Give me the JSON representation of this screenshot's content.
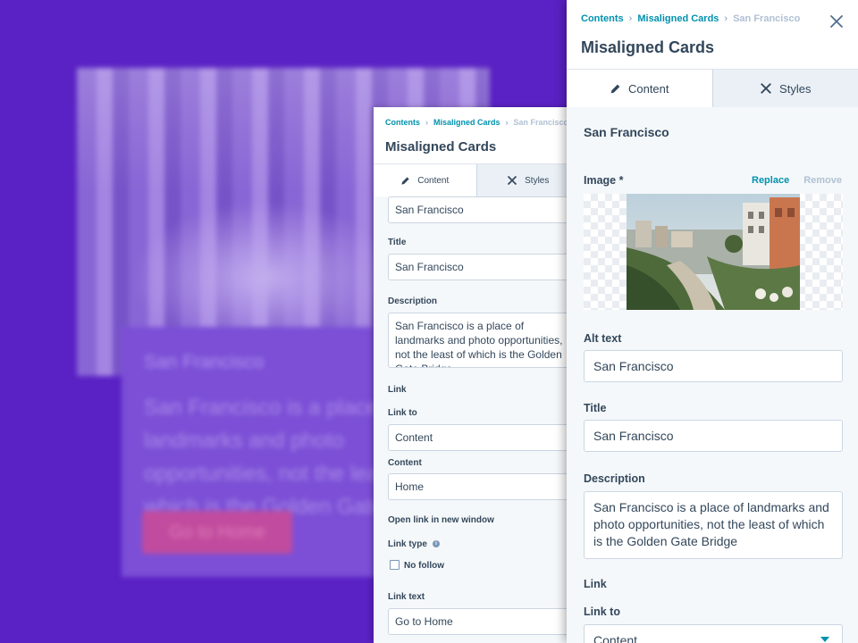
{
  "background_card": {
    "title": "San Francisco",
    "description": "San Francisco is a place of landmarks and photo opportunities, not the least of which is the Golden Gate Bridge",
    "button_label": "Go to Home"
  },
  "mid_panel": {
    "breadcrumb": [
      "Contents",
      "Misaligned Cards",
      "San Francisco"
    ],
    "title": "Misaligned Cards",
    "tabs": [
      {
        "label": "Content"
      },
      {
        "label": "Styles"
      }
    ],
    "alt_text_value": "San Francisco",
    "title_label": "Title",
    "title_value": "San Francisco",
    "description_label": "Description",
    "description_value": "San Francisco is a place of landmarks and photo opportunities, not the least of which is the Golden Gate Bridge",
    "link_heading": "Link",
    "link_to_label": "Link to",
    "link_to_value": "Content",
    "content_label": "Content",
    "content_value": "Home",
    "open_new_window_label": "Open link in new window",
    "link_type_label": "Link type",
    "no_follow_label": "No follow",
    "link_text_label": "Link text",
    "link_text_value": "Go to Home"
  },
  "right_panel": {
    "breadcrumb": [
      "Contents",
      "Misaligned Cards",
      "San Francisco"
    ],
    "title": "Misaligned Cards",
    "tabs": [
      {
        "label": "Content"
      },
      {
        "label": "Styles"
      }
    ],
    "section_title": "San Francisco",
    "image_label": "Image *",
    "replace_label": "Replace",
    "remove_label": "Remove",
    "alt_text_label": "Alt text",
    "alt_text_value": "San Francisco",
    "title_label": "Title",
    "title_value": "San Francisco",
    "description_label": "Description",
    "description_value": "San Francisco is a place of landmarks and photo opportunities, not the least of which is the Golden Gate Bridge",
    "link_heading": "Link",
    "link_to_label": "Link to",
    "link_to_value": "Content"
  },
  "colors": {
    "backdrop": "#5a21c4",
    "accent": "#0091ae",
    "text": "#33475b",
    "muted": "#b0c1d4"
  },
  "icons": [
    "pencil-icon",
    "styles-icon",
    "close-icon",
    "info-icon",
    "chevron-down-icon"
  ]
}
